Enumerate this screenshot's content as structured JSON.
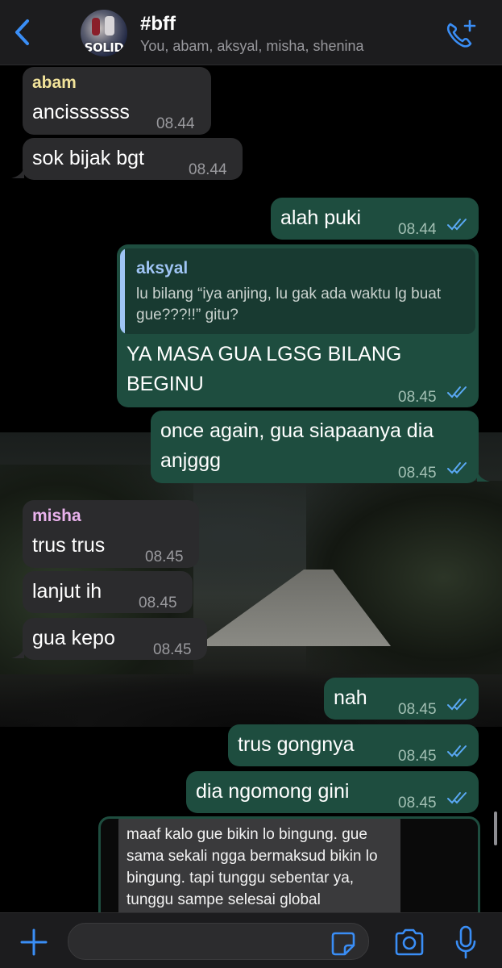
{
  "header": {
    "back_icon": "chevron-left-icon",
    "avatar_text": "SOLID",
    "title": "#bff",
    "participants": "You, abam, aksyal, misha, shenina",
    "call_icon": "phone-plus-icon",
    "accent": "#3a8ef6"
  },
  "messages": [
    {
      "dir": "in",
      "sender": "abam",
      "sender_color": "#f2e39a",
      "text": "ancissssss",
      "time": "08.44"
    },
    {
      "dir": "in",
      "text": "sok bijak bgt",
      "time": "08.44"
    },
    {
      "dir": "out",
      "text": "alah puki",
      "time": "08.44"
    },
    {
      "dir": "out",
      "reply_sender": "aksyal",
      "reply_text": "lu bilang “iya anjing, lu gak ada waktu lg buat gue???!!” gitu?",
      "text": "YA MASA GUA LGSG BILANG BEGINU",
      "time": "08.45"
    },
    {
      "dir": "out",
      "text": "once again, gua siapaanya dia anjggg",
      "time": "08.45"
    },
    {
      "dir": "in",
      "sender": "misha",
      "sender_color": "#e9b2ec",
      "text": "trus trus",
      "time": "08.45"
    },
    {
      "dir": "in",
      "text": "lanjut ih",
      "time": "08.45"
    },
    {
      "dir": "in",
      "text": "gua kepo",
      "time": "08.45"
    },
    {
      "dir": "out",
      "text": "nah",
      "time": "08.45"
    },
    {
      "dir": "out",
      "text": "trus gongnya",
      "time": "08.45"
    },
    {
      "dir": "out",
      "text": "dia ngomong gini",
      "time": "08.45"
    },
    {
      "dir": "out",
      "image_text": "maaf kalo gue bikin lo bingung. gue sama sekali ngga bermaksud bikin lo bingung. tapi tunggu sebentar ya, tunggu sampe selesai global"
    }
  ],
  "colors": {
    "incoming_bubble": "#2b2b2d",
    "outgoing_bubble": "#1e4d3f",
    "read_ticks": "#5aa9f5"
  },
  "input_bar": {
    "add_icon": "plus-icon",
    "sticker_icon": "sticker-icon",
    "camera_icon": "camera-icon",
    "mic_icon": "microphone-icon"
  }
}
